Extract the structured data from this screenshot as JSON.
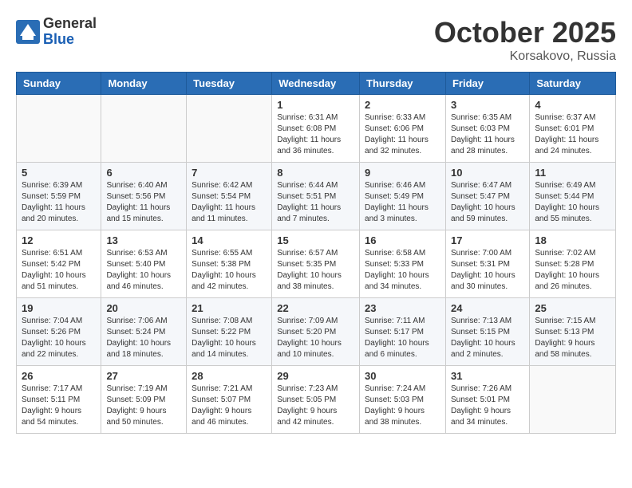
{
  "header": {
    "logo_general": "General",
    "logo_blue": "Blue",
    "month_title": "October 2025",
    "location": "Korsakovo, Russia"
  },
  "days_of_week": [
    "Sunday",
    "Monday",
    "Tuesday",
    "Wednesday",
    "Thursday",
    "Friday",
    "Saturday"
  ],
  "weeks": [
    [
      {
        "day": "",
        "info": ""
      },
      {
        "day": "",
        "info": ""
      },
      {
        "day": "",
        "info": ""
      },
      {
        "day": "1",
        "info": "Sunrise: 6:31 AM\nSunset: 6:08 PM\nDaylight: 11 hours\nand 36 minutes."
      },
      {
        "day": "2",
        "info": "Sunrise: 6:33 AM\nSunset: 6:06 PM\nDaylight: 11 hours\nand 32 minutes."
      },
      {
        "day": "3",
        "info": "Sunrise: 6:35 AM\nSunset: 6:03 PM\nDaylight: 11 hours\nand 28 minutes."
      },
      {
        "day": "4",
        "info": "Sunrise: 6:37 AM\nSunset: 6:01 PM\nDaylight: 11 hours\nand 24 minutes."
      }
    ],
    [
      {
        "day": "5",
        "info": "Sunrise: 6:39 AM\nSunset: 5:59 PM\nDaylight: 11 hours\nand 20 minutes."
      },
      {
        "day": "6",
        "info": "Sunrise: 6:40 AM\nSunset: 5:56 PM\nDaylight: 11 hours\nand 15 minutes."
      },
      {
        "day": "7",
        "info": "Sunrise: 6:42 AM\nSunset: 5:54 PM\nDaylight: 11 hours\nand 11 minutes."
      },
      {
        "day": "8",
        "info": "Sunrise: 6:44 AM\nSunset: 5:51 PM\nDaylight: 11 hours\nand 7 minutes."
      },
      {
        "day": "9",
        "info": "Sunrise: 6:46 AM\nSunset: 5:49 PM\nDaylight: 11 hours\nand 3 minutes."
      },
      {
        "day": "10",
        "info": "Sunrise: 6:47 AM\nSunset: 5:47 PM\nDaylight: 10 hours\nand 59 minutes."
      },
      {
        "day": "11",
        "info": "Sunrise: 6:49 AM\nSunset: 5:44 PM\nDaylight: 10 hours\nand 55 minutes."
      }
    ],
    [
      {
        "day": "12",
        "info": "Sunrise: 6:51 AM\nSunset: 5:42 PM\nDaylight: 10 hours\nand 51 minutes."
      },
      {
        "day": "13",
        "info": "Sunrise: 6:53 AM\nSunset: 5:40 PM\nDaylight: 10 hours\nand 46 minutes."
      },
      {
        "day": "14",
        "info": "Sunrise: 6:55 AM\nSunset: 5:38 PM\nDaylight: 10 hours\nand 42 minutes."
      },
      {
        "day": "15",
        "info": "Sunrise: 6:57 AM\nSunset: 5:35 PM\nDaylight: 10 hours\nand 38 minutes."
      },
      {
        "day": "16",
        "info": "Sunrise: 6:58 AM\nSunset: 5:33 PM\nDaylight: 10 hours\nand 34 minutes."
      },
      {
        "day": "17",
        "info": "Sunrise: 7:00 AM\nSunset: 5:31 PM\nDaylight: 10 hours\nand 30 minutes."
      },
      {
        "day": "18",
        "info": "Sunrise: 7:02 AM\nSunset: 5:28 PM\nDaylight: 10 hours\nand 26 minutes."
      }
    ],
    [
      {
        "day": "19",
        "info": "Sunrise: 7:04 AM\nSunset: 5:26 PM\nDaylight: 10 hours\nand 22 minutes."
      },
      {
        "day": "20",
        "info": "Sunrise: 7:06 AM\nSunset: 5:24 PM\nDaylight: 10 hours\nand 18 minutes."
      },
      {
        "day": "21",
        "info": "Sunrise: 7:08 AM\nSunset: 5:22 PM\nDaylight: 10 hours\nand 14 minutes."
      },
      {
        "day": "22",
        "info": "Sunrise: 7:09 AM\nSunset: 5:20 PM\nDaylight: 10 hours\nand 10 minutes."
      },
      {
        "day": "23",
        "info": "Sunrise: 7:11 AM\nSunset: 5:17 PM\nDaylight: 10 hours\nand 6 minutes."
      },
      {
        "day": "24",
        "info": "Sunrise: 7:13 AM\nSunset: 5:15 PM\nDaylight: 10 hours\nand 2 minutes."
      },
      {
        "day": "25",
        "info": "Sunrise: 7:15 AM\nSunset: 5:13 PM\nDaylight: 9 hours\nand 58 minutes."
      }
    ],
    [
      {
        "day": "26",
        "info": "Sunrise: 7:17 AM\nSunset: 5:11 PM\nDaylight: 9 hours\nand 54 minutes."
      },
      {
        "day": "27",
        "info": "Sunrise: 7:19 AM\nSunset: 5:09 PM\nDaylight: 9 hours\nand 50 minutes."
      },
      {
        "day": "28",
        "info": "Sunrise: 7:21 AM\nSunset: 5:07 PM\nDaylight: 9 hours\nand 46 minutes."
      },
      {
        "day": "29",
        "info": "Sunrise: 7:23 AM\nSunset: 5:05 PM\nDaylight: 9 hours\nand 42 minutes."
      },
      {
        "day": "30",
        "info": "Sunrise: 7:24 AM\nSunset: 5:03 PM\nDaylight: 9 hours\nand 38 minutes."
      },
      {
        "day": "31",
        "info": "Sunrise: 7:26 AM\nSunset: 5:01 PM\nDaylight: 9 hours\nand 34 minutes."
      },
      {
        "day": "",
        "info": ""
      }
    ]
  ]
}
